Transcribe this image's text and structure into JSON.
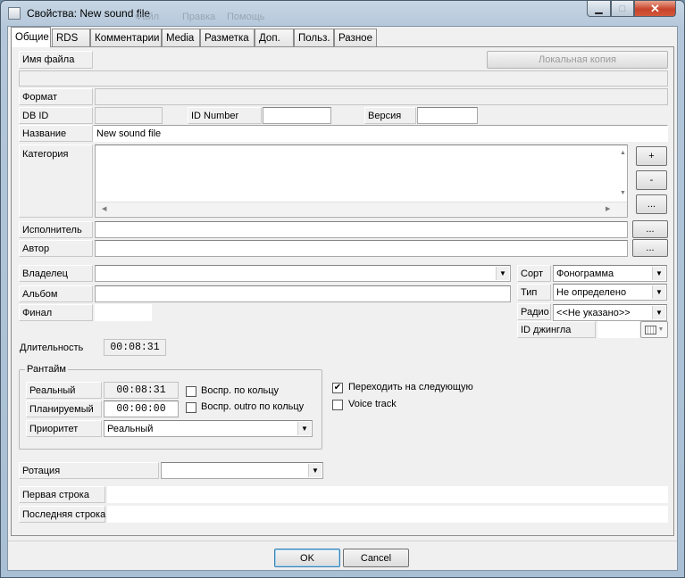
{
  "window": {
    "title": "Свойства: New sound file",
    "background_menu": [
      "Файл",
      "Правка",
      "Статус",
      "Помощь"
    ],
    "minimize_glyph": "▁",
    "maximize_glyph": "□",
    "close_glyph": "✕"
  },
  "tabs": [
    {
      "label": "Общие",
      "active": true
    },
    {
      "label": "RDS"
    },
    {
      "label": "Комментарии"
    },
    {
      "label": "Media"
    },
    {
      "label": "Разметка"
    },
    {
      "label": "Доп."
    },
    {
      "label": "Польз."
    },
    {
      "label": "Разное"
    }
  ],
  "general": {
    "file_name_label": "Имя файла",
    "local_copy_button": "Локальная копия",
    "file_name_value": "",
    "format_label": "Формат",
    "format_value": "",
    "db_id_label": "DB ID",
    "db_id_value": "",
    "id_number_label": "ID Number",
    "id_number_value": "",
    "version_label": "Версия",
    "version_value": "",
    "name_label": "Название",
    "name_value": "New sound file",
    "category_label": "Категория",
    "category_add": "+",
    "category_remove": "-",
    "category_more": "...",
    "artist_label": "Исполнитель",
    "artist_value": "",
    "artist_more": "...",
    "author_label": "Автор",
    "author_value": "",
    "author_more": "...",
    "owner_label": "Владелец",
    "owner_value": "",
    "album_label": "Альбом",
    "album_value": "",
    "final_label": "Финал",
    "final_value": "",
    "sort_label": "Сорт",
    "sort_value": "Фонограмма",
    "type_label": "Тип",
    "type_value": "Не определено",
    "radio_label": "Радио",
    "radio_value": "<<Не указано>>",
    "jingle_id_label": "ID джингла",
    "jingle_id_value": "",
    "duration_label": "Длительность",
    "duration_value": "00:08:31"
  },
  "runtime": {
    "title": "Рантайм",
    "real_label": "Реальный",
    "real_value": "00:08:31",
    "planned_label": "Планируемый",
    "planned_value": "00:00:00",
    "priority_label": "Приоритет",
    "priority_value": "Реальный",
    "loop_label": "Воспр. по кольцу",
    "loop_checked": false,
    "outro_loop_label": "Воспр. outro по кольцу",
    "outro_loop_checked": false
  },
  "options": {
    "go_next_label": "Переходить на следующую",
    "go_next_checked": true,
    "voice_track_label": "Voice track",
    "voice_track_checked": false,
    "check_glyph": "✔"
  },
  "rotation": {
    "label": "Ротация",
    "value": ""
  },
  "lines": {
    "first_label": "Первая строка",
    "first_value": "",
    "last_label": "Последняя строка",
    "last_value": ""
  },
  "footer": {
    "ok": "OK",
    "cancel": "Cancel"
  },
  "icons": {
    "dropdown": "▼",
    "scroll_up": "▲",
    "scroll_down": "▼",
    "scroll_left": "◀",
    "scroll_right": "▶"
  }
}
